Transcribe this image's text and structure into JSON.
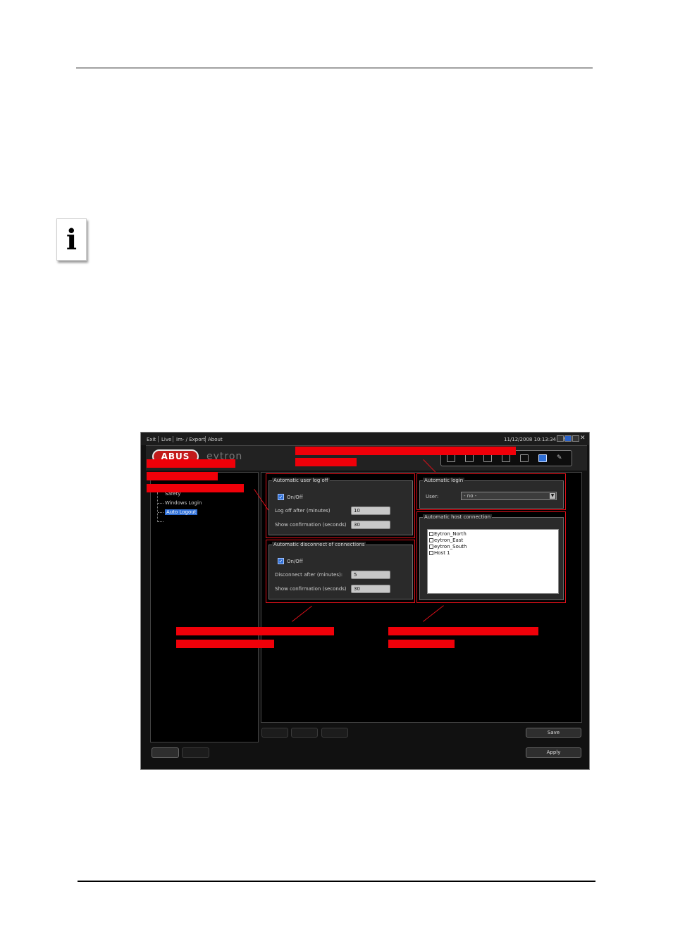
{
  "app": {
    "menu": [
      "Exit",
      "Live",
      "Im- / Export",
      "About"
    ],
    "datetime": "11/12/2008 10:13:34 AM",
    "logo_text": "ABUS",
    "brand": "eytron"
  },
  "tree": {
    "items": [
      {
        "label": "Safety",
        "selected": false
      },
      {
        "label": "Windows Login",
        "selected": false
      },
      {
        "label": "Auto Logout",
        "selected": true
      }
    ]
  },
  "user_logoff": {
    "title": "Automatic user log off",
    "onoff_label": "On/Off",
    "logoff_label": "Log off after (minutes)",
    "logoff_value": "10",
    "confirm_label": "Show confirmation (seconds)",
    "confirm_value": "30"
  },
  "disconnect": {
    "title": "Automatic disconnect of connections",
    "onoff_label": "On/Off",
    "disconnect_label": "Disconnect after (minutes):",
    "disconnect_value": "5",
    "confirm_label": "Show confirmation (seconds)",
    "confirm_value": "30"
  },
  "auto_login": {
    "title": "Automatic login",
    "user_label": "User:",
    "user_value": "- no -"
  },
  "host_connection": {
    "title": "Automatic host connection",
    "hosts": [
      "Eytron_North",
      "eytron_East",
      "eytron_South",
      "Host 1"
    ]
  },
  "buttons": {
    "save": "Save",
    "apply": "Apply"
  },
  "colors": {
    "accent": "#2f6fd6",
    "annotation_red": "#f00009"
  }
}
